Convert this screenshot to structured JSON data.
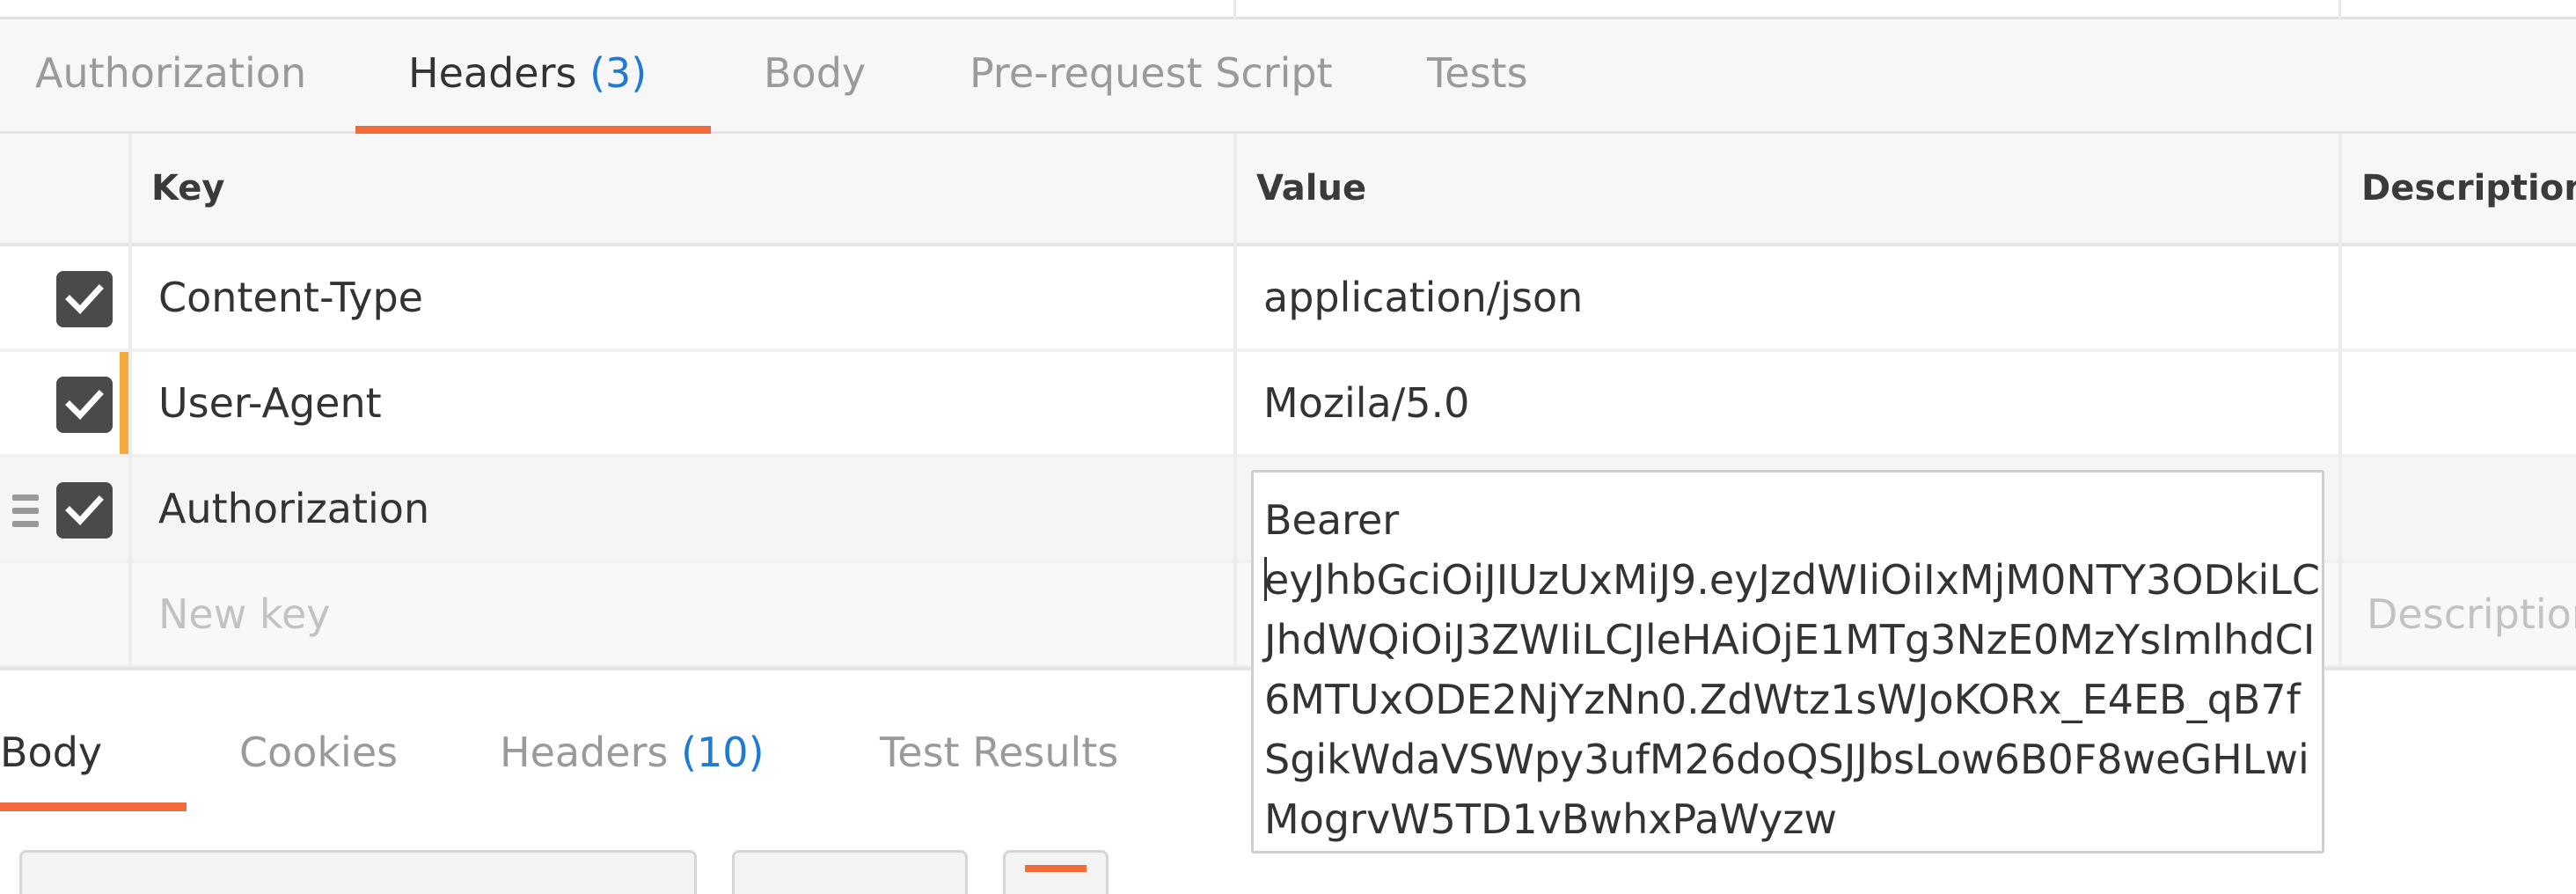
{
  "request_tabs": [
    {
      "label": "Authorization",
      "count": ""
    },
    {
      "label": "Headers",
      "count": "(3)"
    },
    {
      "label": "Body",
      "count": ""
    },
    {
      "label": "Pre-request Script",
      "count": ""
    },
    {
      "label": "Tests",
      "count": ""
    }
  ],
  "active_request_tab": "Headers",
  "headers_table": {
    "columns": {
      "key": "Key",
      "value": "Value",
      "description": "Description"
    },
    "rows": [
      {
        "checked": true,
        "key": "Content-Type",
        "value": "application/json",
        "description": ""
      },
      {
        "checked": true,
        "key": "User-Agent",
        "value": "Mozila/5.0",
        "description": ""
      },
      {
        "checked": true,
        "key": "Authorization",
        "value": "",
        "description": ""
      }
    ],
    "new_row": {
      "key_placeholder": "New key",
      "description_placeholder": "Description"
    }
  },
  "value_editor": {
    "line1": "Bearer",
    "token": "eyJhbGciOiJIUzUxMiJ9.eyJzdWIiOiIxMjM0NTY3ODkiLCJhdWQiOiJ3ZWIiLCJleHAiOjE1MTg3NzE0MzYsImlhdCI6MTUxODE2NjYzNn0.ZdWtz1sWJoKORx_E4EB_qB7fSgikWdaVSWpy3ufM26doQSJJbsLow6B0F8weGHLwiMogrvW5TD1vBwhxPaWyzw"
  },
  "response_tabs": [
    {
      "label": "Body",
      "count": ""
    },
    {
      "label": "Cookies",
      "count": ""
    },
    {
      "label": "Headers",
      "count": "(10)"
    },
    {
      "label": "Test Results",
      "count": ""
    }
  ],
  "active_response_tab": "Body",
  "colors": {
    "accent": "#f26b3a",
    "count_blue": "#1f7ad4",
    "modified_marker": "#f2ab3b"
  }
}
